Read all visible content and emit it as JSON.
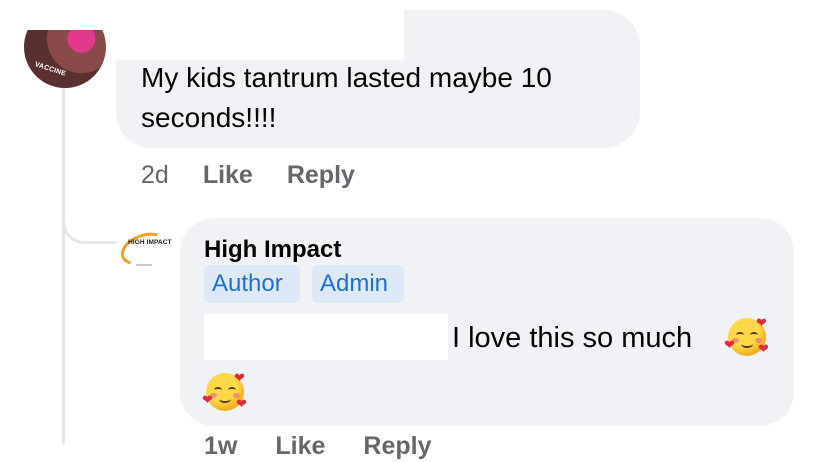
{
  "comment": {
    "text": "My kids tantrum lasted maybe 10 seconds!!!!",
    "avatar_badge": "VACCINE",
    "time": "2d",
    "like_label": "Like",
    "reply_label": "Reply"
  },
  "reply": {
    "author": "High Impact",
    "badges": [
      "Author",
      "Admin"
    ],
    "text": "I love this so much",
    "logo_text": "HIGH IMPACT",
    "emoji": "smiling-face-with-hearts",
    "time": "1w",
    "like_label": "Like",
    "reply_label": "Reply"
  },
  "colors": {
    "bubble": "#f0f2f5",
    "meta": "#65676b",
    "chip_bg": "#dde9f7",
    "chip_text": "#1f6fd0",
    "thread_line": "#e4e6eb"
  }
}
